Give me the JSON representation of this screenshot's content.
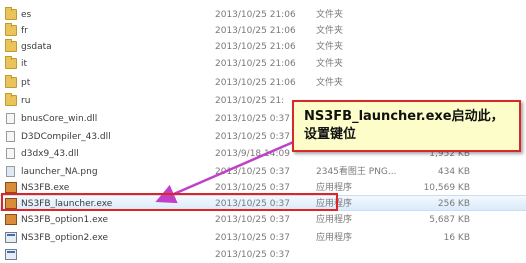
{
  "files": [
    {
      "name": "es",
      "date": "2013/10/25 21:06",
      "type": "文件夹",
      "size": "",
      "icon": "folder-icon"
    },
    {
      "name": "fr",
      "date": "2013/10/25 21:06",
      "type": "文件夹",
      "size": "",
      "icon": "folder-icon"
    },
    {
      "name": "gsdata",
      "date": "2013/10/25 21:06",
      "type": "文件夹",
      "size": "",
      "icon": "folder-icon"
    },
    {
      "name": "it",
      "date": "2013/10/25 21:06",
      "type": "文件夹",
      "size": "",
      "icon": "folder-icon"
    },
    {
      "name": "pt",
      "date": "2013/10/25 21:06",
      "type": "文件夹",
      "size": "",
      "icon": "folder-icon"
    },
    {
      "name": "ru",
      "date": "2013/10/25 21:",
      "type": "",
      "size": "",
      "icon": "folder-icon"
    },
    {
      "name": "bnusCore_win.dll",
      "date": "2013/10/25 0:37",
      "type": "",
      "size": "",
      "icon": "dll-file-icon"
    },
    {
      "name": "D3DCompiler_43.dll",
      "date": "2013/10/25 0:37",
      "type": "",
      "size": "",
      "icon": "dll-file-icon"
    },
    {
      "name": "d3dx9_43.dll",
      "date": "2013/9/18 14:09",
      "type": "",
      "size": "1,952 KB",
      "icon": "dll-file-icon"
    },
    {
      "name": "launcher_NA.png",
      "date": "2013/10/25 0:37",
      "type": "2345看图王 PNG...",
      "size": "434 KB",
      "icon": "png-file-icon"
    },
    {
      "name": "NS3FB.exe",
      "date": "2013/10/25 0:37",
      "type": "应用程序",
      "size": "10,569 KB",
      "icon": "exe-icon"
    },
    {
      "name": "NS3FB_launcher.exe",
      "date": "2013/10/25 0:37",
      "type": "应用程序",
      "size": "256 KB",
      "icon": "exe-icon"
    },
    {
      "name": "NS3FB_option1.exe",
      "date": "2013/10/25 0:37",
      "type": "应用程序",
      "size": "5,687 KB",
      "icon": "exe-icon"
    },
    {
      "name": "NS3FB_option2.exe",
      "date": "2013/10/25 0:37",
      "type": "应用程序",
      "size": "16 KB",
      "icon": "exe-icon"
    },
    {
      "name": "",
      "date": "2013/10/25 0:37",
      "type": "",
      "size": "",
      "icon": "exe-icon"
    }
  ],
  "callout": {
    "text": "NS3FB_launcher.exe启动此，设置键位"
  },
  "colors": {
    "highlight": "#e02323",
    "callout_bg": "#fdfdc9",
    "arrow": "#c040c8"
  }
}
